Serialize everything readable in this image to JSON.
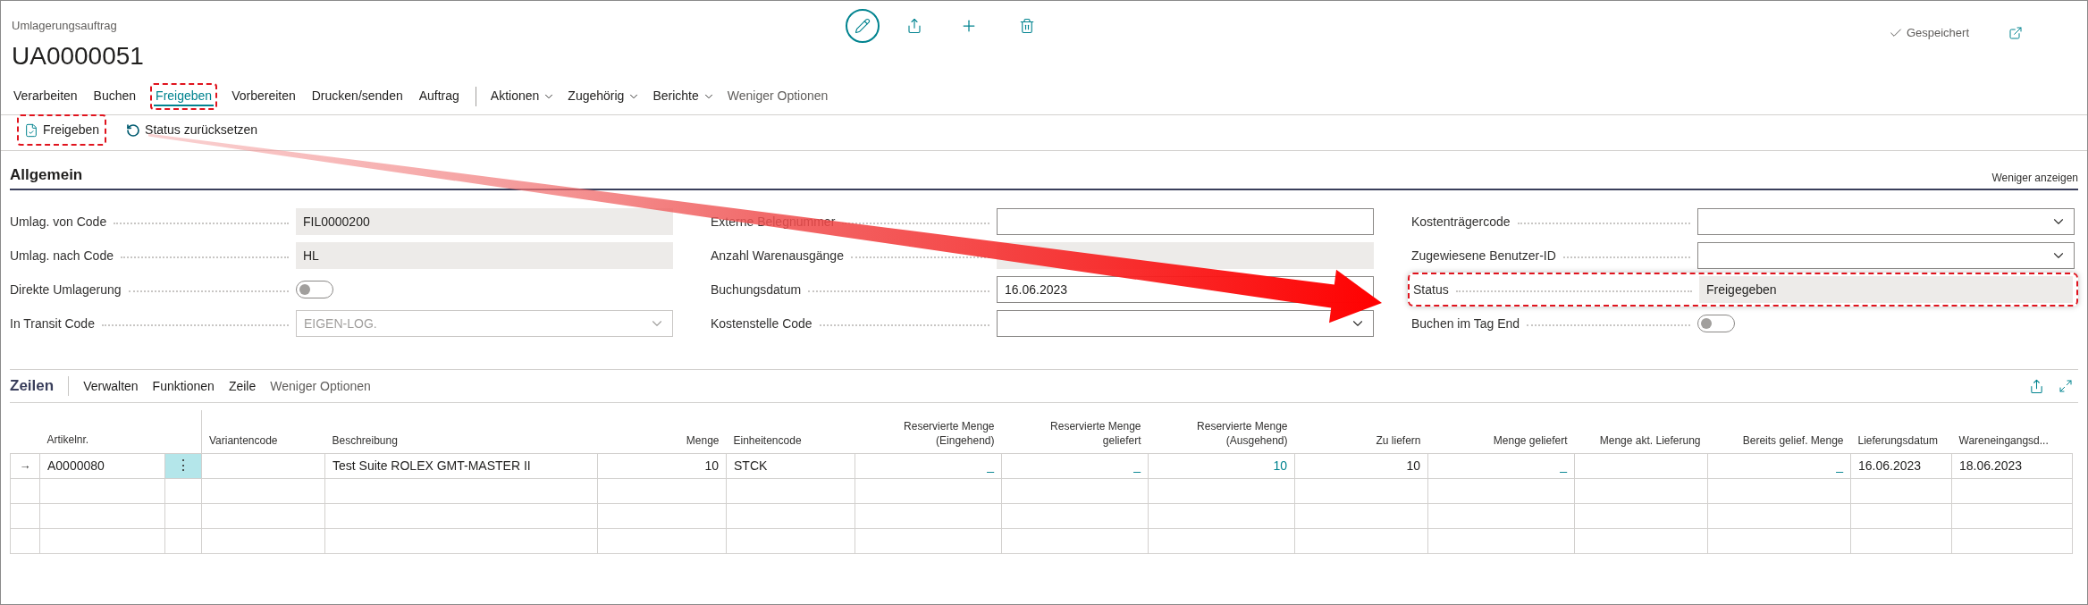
{
  "page": {
    "caption": "Umlagerungsauftrag",
    "title": "UA0000051",
    "save_state": "Gespeichert"
  },
  "menu": [
    {
      "label": "Verarbeiten",
      "kind": "tab",
      "selected": false
    },
    {
      "label": "Buchen",
      "kind": "tab",
      "selected": false
    },
    {
      "label": "Freigeben",
      "kind": "tab",
      "selected": true,
      "highlighted": true
    },
    {
      "label": "Vorbereiten",
      "kind": "tab",
      "selected": false
    },
    {
      "label": "Drucken/senden",
      "kind": "tab",
      "selected": false
    },
    {
      "label": "Auftrag",
      "kind": "tab",
      "selected": false
    },
    {
      "label": "Aktionen",
      "kind": "menu"
    },
    {
      "label": "Zugehörig",
      "kind": "menu"
    },
    {
      "label": "Berichte",
      "kind": "menu"
    },
    {
      "label": "Weniger Optionen",
      "kind": "more"
    }
  ],
  "actions": [
    {
      "label": "Freigeben",
      "kind": "release",
      "highlighted": true
    },
    {
      "label": "Status zurücksetzen",
      "kind": "reset"
    }
  ],
  "general": {
    "title": "Allgemein",
    "toggle_link": "Weniger anzeigen",
    "columns": [
      [
        {
          "label": "Umlag. von Code",
          "kind": "readonly",
          "value": "FIL0000200"
        },
        {
          "label": "Umlag. nach Code",
          "kind": "readonly",
          "value": "HL"
        },
        {
          "label": "Direkte Umlagerung",
          "kind": "toggle",
          "on": false
        },
        {
          "label": "In Transit Code",
          "kind": "select",
          "value": "EIGEN-LOG.",
          "disabled": true
        }
      ],
      [
        {
          "label": "Externe Belegnummer",
          "kind": "input"
        },
        {
          "label": "Anzahl Warenausgänge",
          "kind": "readonly"
        },
        {
          "label": "Buchungsdatum",
          "kind": "input",
          "value": "16.06.2023"
        },
        {
          "label": "Kostenstelle Code",
          "kind": "select",
          "disabled": false
        }
      ],
      [
        {
          "label": "Kostenträgercode",
          "kind": "select",
          "disabled": false
        },
        {
          "label": "Zugewiesene Benutzer-ID",
          "kind": "select",
          "disabled": false
        },
        {
          "label": "Status",
          "kind": "readonly",
          "value": "Freigegeben",
          "highlighted": true
        },
        {
          "label": "Buchen im Tag End",
          "kind": "toggle",
          "on": false
        }
      ]
    ]
  },
  "lines": {
    "title": "Zeilen",
    "menu": [
      "Verwalten",
      "Funktionen",
      "Zeile"
    ],
    "more": "Weniger Optionen",
    "columns": [
      "Artikelnr.",
      "Variantencode",
      "Beschreibung",
      "Menge",
      "Einheitencode",
      "Reservierte Menge (Eingehend)",
      "Reservierte Menge geliefert",
      "Reservierte Menge (Ausgehend)",
      "Zu liefern",
      "Menge geliefert",
      "Menge akt. Lieferung",
      "Bereits gelief. Menge",
      "Lieferungsdatum",
      "Wareneingangsd..."
    ],
    "rows": [
      {
        "marker": "→",
        "menu": "⋮",
        "selected": true,
        "cells": [
          {
            "text": "A0000080",
            "link": false
          },
          null,
          {
            "text": "Test Suite ROLEX GMT-MASTER II",
            "link": false
          },
          {
            "text": "10",
            "link": false
          },
          {
            "text": "STCK",
            "link": false
          },
          {
            "text": "_",
            "link": true
          },
          {
            "text": "_",
            "link": true
          },
          {
            "text": "10",
            "link": true
          },
          {
            "text": "10",
            "link": false
          },
          {
            "text": "_",
            "link": true
          },
          null,
          {
            "text": "_",
            "link": true
          },
          {
            "text": "16.06.2023",
            "link": false
          },
          {
            "text": "18.06.2023",
            "link": false
          }
        ]
      }
    ]
  }
}
